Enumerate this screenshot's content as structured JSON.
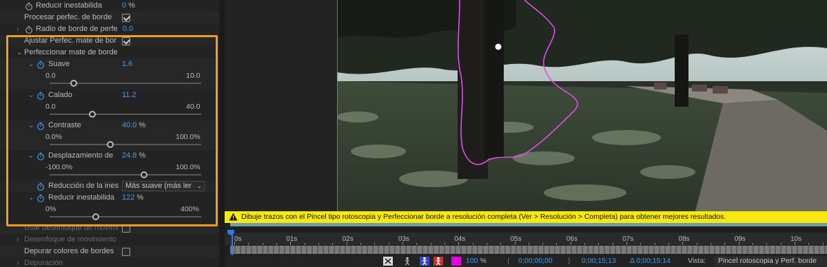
{
  "effect_panel": {
    "rows": {
      "reduce_jitter_top_label": "Reducir inestabilida",
      "reduce_jitter_top_value": "0",
      "reduce_jitter_top_unit": "%",
      "process_refine_label": "Procesar perfec. de borde",
      "radius_label": "Radio de borde de perfe",
      "radius_value": "0.0",
      "adjust_refine_label": "Ajustar Perfec. mate de bor",
      "refine_matte_label": "Perfeccionar mate de borde",
      "smooth_label": "Suave",
      "smooth_value": "1.6",
      "smooth_min": "0.0",
      "smooth_max": "10.0",
      "feather_label": "Calado",
      "feather_value": "11.2",
      "feather_min": "0.0",
      "feather_max": "40.0",
      "contrast_label": "Contraste",
      "contrast_value": "40.0",
      "contrast_unit": "%",
      "contrast_min": "0.0%",
      "contrast_max": "100.0%",
      "shift_label": "Desplazamiento de",
      "shift_value": "24.8",
      "shift_unit": "%",
      "shift_min": "-100.0%",
      "shift_max": "100.0%",
      "jitter_reduction_label": "Reducción de la ines",
      "jitter_reduction_option": "Más suave (más ler",
      "reduce_jitter_label": "Reducir inestabilida",
      "reduce_jitter_value": "122",
      "reduce_jitter_unit": "%",
      "reduce_jitter_min": "0%",
      "reduce_jitter_max": "400%",
      "motion_blur_use_label": "Usar desenfoque de movimi",
      "motion_blur_label": "Desenfoque de movimiento",
      "decontaminate_label": "Depurar colores de bordes",
      "debug_label": "Depuración"
    },
    "slider_levels": {
      "smooth": 0.16,
      "feather": 0.28,
      "contrast": 0.4,
      "shift": 0.624,
      "reduce_jitter": 0.305
    },
    "checkboxes": {
      "process_refine": true,
      "adjust_refine": true,
      "motion_blur_use": false,
      "decontaminate": false
    }
  },
  "warning": {
    "text": "Dibuje trazos con el Pincel tipo rotoscopia y Perfeccionar borde a resolución completa (Ver > Resolución > Completa) para obtener mejores resultados."
  },
  "timeline": {
    "ticks": [
      "0s",
      "01s",
      "02s",
      "03s",
      "04s",
      "05s",
      "06s",
      "07s",
      "08s",
      "09s",
      "10s"
    ]
  },
  "toolbar": {
    "zoom": "100",
    "zoom_unit": "%",
    "in_time": "0;00;00;00",
    "out_time": "0;00;15;13",
    "duration": "Δ 0;00;15;14",
    "view_label": "Vista:",
    "view_value": "Pincel rotoscopia y Perf. borde"
  },
  "colors": {
    "accent_value": "#3d9df3",
    "highlight": "#f39c1f",
    "warning_bg": "#f7e80f",
    "matte_outline": "#e24ee6"
  },
  "icons": {
    "stopwatch": "stopwatch-icon",
    "twirl": "chevron-icon",
    "warning": "warning-icon"
  }
}
